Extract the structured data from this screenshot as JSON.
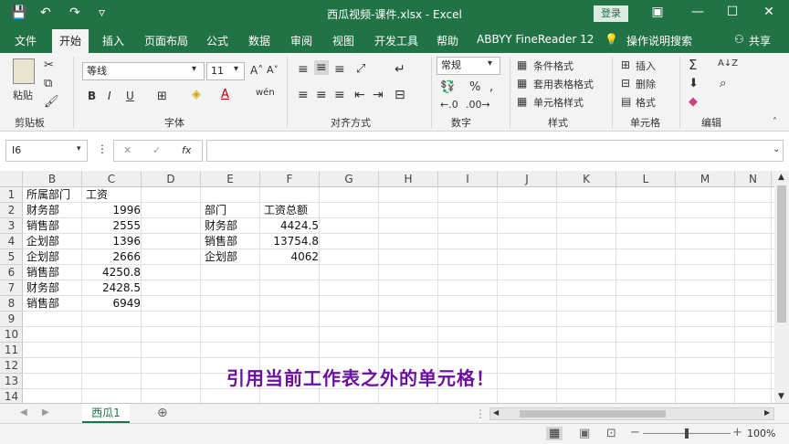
{
  "window": {
    "title": "西瓜视频-课件.xlsx  -  Excel",
    "login_label": "登录",
    "minimize_glyph": "—",
    "restore_glyph": "☐",
    "close_glyph": "✕",
    "ribbon_toggle_glyph": "▣"
  },
  "quick_access": {
    "save_glyph": "💾",
    "undo_glyph": "↶",
    "redo_glyph": "↷",
    "customize_glyph": "▿"
  },
  "menu": {
    "file": "文件",
    "home": "开始",
    "insert": "插入",
    "page_layout": "页面布局",
    "formulas": "公式",
    "data": "数据",
    "review": "审阅",
    "view": "视图",
    "developer": "开发工具",
    "help": "帮助",
    "abbyy": "ABBYY FineReader 12",
    "tell_me": "操作说明搜索",
    "share": "共享"
  },
  "ribbon": {
    "clipboard": {
      "label": "剪贴板",
      "paste": "粘贴"
    },
    "font": {
      "label": "字体",
      "font_name": "等线",
      "font_size": "11",
      "bold": "B",
      "italic": "I",
      "underline": "U",
      "grow": "A˄",
      "shrink": "A˅",
      "font_color": "A",
      "phonetic": "wén"
    },
    "alignment": {
      "label": "对齐方式"
    },
    "number": {
      "label": "数字",
      "format": "常规",
      "percent": "%",
      "comma": ","
    },
    "styles": {
      "label": "样式",
      "conditional": "条件格式",
      "table": "套用表格格式",
      "cell_styles": "单元格样式"
    },
    "cells": {
      "label": "单元格",
      "insert": "插入",
      "delete": "删除",
      "format": "格式"
    },
    "editing": {
      "label": "编辑",
      "sum": "Σ",
      "sort": "A↓Z",
      "find": "⌕"
    }
  },
  "formula_bar": {
    "name_box": "I6",
    "cancel": "✕",
    "enter": "✓",
    "fx": "fx",
    "formula": ""
  },
  "grid": {
    "columns": [
      "B",
      "C",
      "D",
      "E",
      "F",
      "G",
      "H",
      "I",
      "J",
      "K",
      "L",
      "M",
      "N"
    ],
    "rows": [
      "1",
      "2",
      "3",
      "4",
      "5",
      "6",
      "7",
      "8",
      "9",
      "10",
      "11",
      "12",
      "13",
      "14"
    ],
    "left_table": {
      "header_dept": "所属部门",
      "header_salary": "工资",
      "rows": [
        {
          "dept": "财务部",
          "salary": "1996"
        },
        {
          "dept": "销售部",
          "salary": "2555"
        },
        {
          "dept": "企划部",
          "salary": "1396"
        },
        {
          "dept": "企划部",
          "salary": "2666"
        },
        {
          "dept": "销售部",
          "salary": "4250.8"
        },
        {
          "dept": "财务部",
          "salary": "2428.5"
        },
        {
          "dept": "销售部",
          "salary": "6949"
        }
      ]
    },
    "summary_table": {
      "header_dept": "部门",
      "header_total": "工资总额",
      "rows": [
        {
          "dept": "财务部",
          "total": "4424.5"
        },
        {
          "dept": "销售部",
          "total": "13754.8"
        },
        {
          "dept": "企划部",
          "total": "4062"
        }
      ]
    }
  },
  "overlay_caption": "引用当前工作表之外的单元格！",
  "sheets": {
    "active": "西瓜1",
    "add_glyph": "⊕"
  },
  "status": {
    "zoom": "100%"
  },
  "colors": {
    "excel_green": "#217346",
    "caption_purple": "#6b0f9e"
  }
}
